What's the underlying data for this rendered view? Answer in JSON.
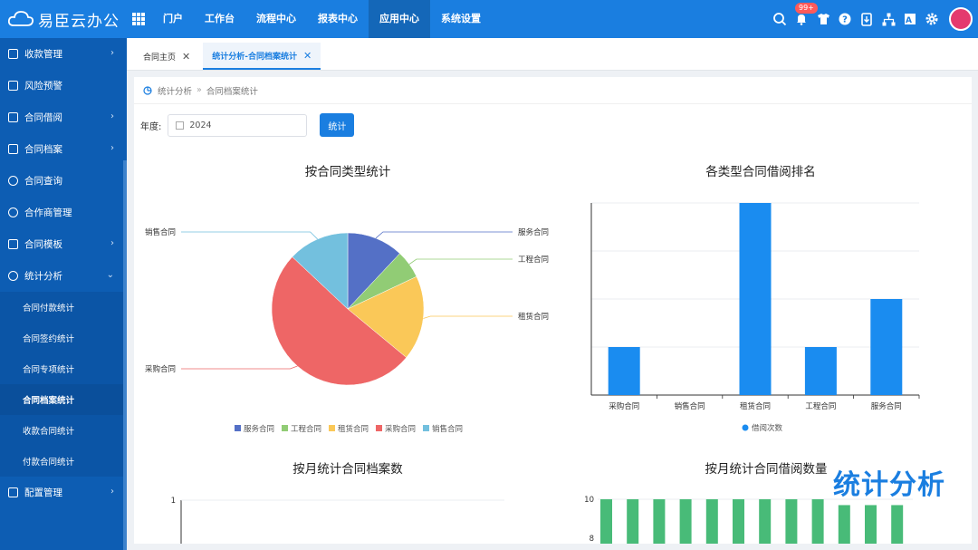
{
  "app": {
    "name": "易臣云办公"
  },
  "top_nav": [
    "门户",
    "工作台",
    "流程中心",
    "报表中心",
    "应用中心",
    "系统设置"
  ],
  "top_nav_active": "应用中心",
  "notification_badge": "99+",
  "sidebar": {
    "items": [
      {
        "label": "收款管理",
        "arrow": "›"
      },
      {
        "label": "风险预警",
        "arrow": ""
      },
      {
        "label": "合同借阅",
        "arrow": "›"
      },
      {
        "label": "合同档案",
        "arrow": "›"
      },
      {
        "label": "合同查询",
        "arrow": ""
      },
      {
        "label": "合作商管理",
        "arrow": ""
      },
      {
        "label": "合同模板",
        "arrow": "›"
      },
      {
        "label": "统计分析",
        "arrow": "⌄"
      }
    ],
    "sub_items": [
      "合同付款统计",
      "合同签约统计",
      "合同专项统计",
      "合同档案统计",
      "收款合同统计",
      "付款合同统计"
    ],
    "active_sub": "合同档案统计",
    "bottom_item": {
      "label": "配置管理",
      "arrow": "›"
    }
  },
  "tabs": [
    {
      "label": "合同主页",
      "close": "✕"
    },
    {
      "label": "统计分析-合同档案统计",
      "close": "✕"
    }
  ],
  "breadcrumb": {
    "parent": "统计分析",
    "sep": "»",
    "current": "合同档案统计"
  },
  "filter": {
    "label": "年度:",
    "value": "2024",
    "button": "统计"
  },
  "watermark": "统计分析",
  "chart_data": [
    {
      "type": "pie",
      "title": "按合同类型统计",
      "categories": [
        "服务合同",
        "工程合同",
        "租赁合同",
        "采购合同",
        "销售合同"
      ],
      "values": [
        12,
        6,
        18,
        51,
        13
      ],
      "colors": [
        "#5470c6",
        "#91cc75",
        "#fac858",
        "#ee6666",
        "#73c0de"
      ],
      "legend": "bottom"
    },
    {
      "type": "bar",
      "title": "各类型合同借阅排名",
      "categories": [
        "采购合同",
        "销售合同",
        "租赁合同",
        "工程合同",
        "服务合同"
      ],
      "series": [
        {
          "name": "借阅次数",
          "values": [
            1,
            0,
            4,
            1,
            2
          ]
        }
      ],
      "ylim": [
        0,
        4
      ],
      "color": "#1a8cf0",
      "legend": "bottom"
    },
    {
      "type": "line",
      "title": "按月统计合同档案数",
      "yticks": [
        "1"
      ]
    },
    {
      "type": "bar",
      "title": "按月统计合同借阅数量",
      "yticks": [
        "10",
        "8"
      ],
      "values": [
        10,
        10,
        10,
        10,
        10,
        10,
        10,
        10,
        10,
        9.7,
        9.7,
        9.7
      ],
      "color": "#48bb78"
    }
  ]
}
